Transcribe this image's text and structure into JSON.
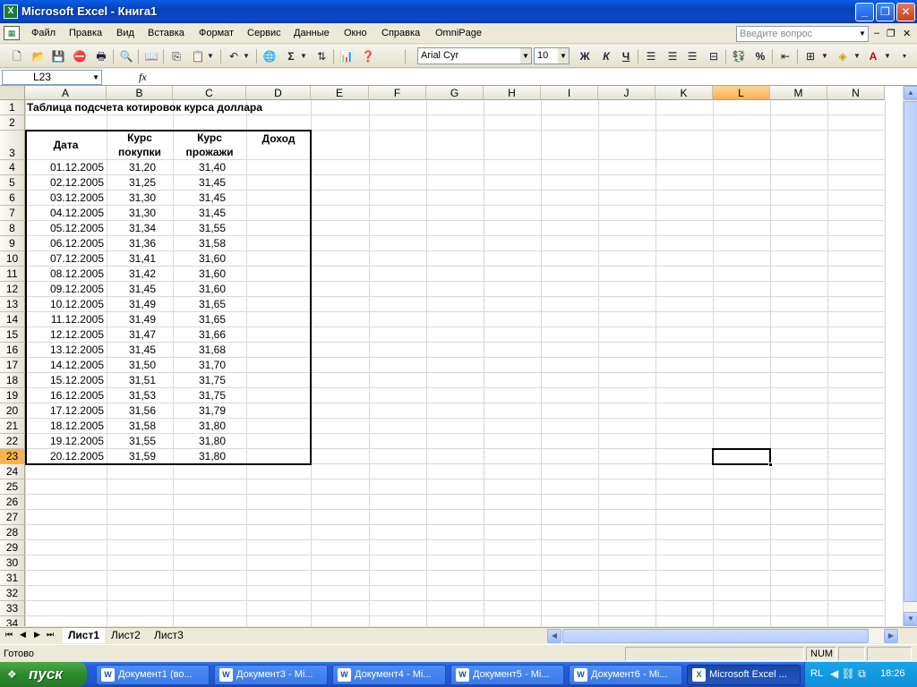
{
  "window": {
    "title": "Microsoft Excel - Книга1",
    "minimize": "_",
    "maximize": "❐",
    "close": "✕"
  },
  "menu": {
    "items": [
      "Файл",
      "Правка",
      "Вид",
      "Вставка",
      "Формат",
      "Сервис",
      "Данные",
      "Окно",
      "Справка",
      "OmniPage"
    ],
    "help_placeholder": "Введите вопрос"
  },
  "toolbar": {
    "font": "Arial Cyr",
    "font_size": "10",
    "bold": "Ж",
    "italic": "К",
    "underline": "Ч",
    "sum": "Σ",
    "percent": "%"
  },
  "formula_bar": {
    "name_box": "L23",
    "fx": "fx",
    "value": ""
  },
  "grid": {
    "columns": [
      "A",
      "B",
      "C",
      "D",
      "E",
      "F",
      "G",
      "H",
      "I",
      "J",
      "K",
      "L",
      "M",
      "N"
    ],
    "active_column": "L",
    "active_row": 23,
    "row_count": 34,
    "title": "Таблица подсчета котировок курса доллара",
    "headers": {
      "date": "Дата",
      "buy_1": "Курс",
      "buy_2": "покупки",
      "sell_1": "Курс",
      "sell_2": "прожажи",
      "income": "Доход"
    },
    "rows": [
      {
        "date": "01.12.2005",
        "buy": "31,20",
        "sell": "31,40"
      },
      {
        "date": "02.12.2005",
        "buy": "31,25",
        "sell": "31,45"
      },
      {
        "date": "03.12.2005",
        "buy": "31,30",
        "sell": "31,45"
      },
      {
        "date": "04.12.2005",
        "buy": "31,30",
        "sell": "31,45"
      },
      {
        "date": "05.12.2005",
        "buy": "31,34",
        "sell": "31,55"
      },
      {
        "date": "06.12.2005",
        "buy": "31,36",
        "sell": "31,58"
      },
      {
        "date": "07.12.2005",
        "buy": "31,41",
        "sell": "31,60"
      },
      {
        "date": "08.12.2005",
        "buy": "31,42",
        "sell": "31,60"
      },
      {
        "date": "09.12.2005",
        "buy": "31,45",
        "sell": "31,60"
      },
      {
        "date": "10.12.2005",
        "buy": "31,49",
        "sell": "31,65"
      },
      {
        "date": "11.12.2005",
        "buy": "31,49",
        "sell": "31,65"
      },
      {
        "date": "12.12.2005",
        "buy": "31,47",
        "sell": "31,66"
      },
      {
        "date": "13.12.2005",
        "buy": "31,45",
        "sell": "31,68"
      },
      {
        "date": "14.12.2005",
        "buy": "31,50",
        "sell": "31,70"
      },
      {
        "date": "15.12.2005",
        "buy": "31,51",
        "sell": "31,75"
      },
      {
        "date": "16.12.2005",
        "buy": "31,53",
        "sell": "31,75"
      },
      {
        "date": "17.12.2005",
        "buy": "31,56",
        "sell": "31,79"
      },
      {
        "date": "18.12.2005",
        "buy": "31,58",
        "sell": "31,80"
      },
      {
        "date": "19.12.2005",
        "buy": "31,55",
        "sell": "31,80"
      },
      {
        "date": "20.12.2005",
        "buy": "31,59",
        "sell": "31,80"
      }
    ]
  },
  "sheets": {
    "tabs": [
      "Лист1",
      "Лист2",
      "Лист3"
    ],
    "active": "Лист1"
  },
  "status": {
    "text": "Готово",
    "num": "NUM"
  },
  "taskbar": {
    "start": "пуск",
    "tasks": [
      "Документ1 (во...",
      "Документ3 - Mi...",
      "Документ4 - Mi...",
      "Документ5 - Mi...",
      "Документ6 - Mi...",
      "Microsoft Excel ..."
    ],
    "active_task": 5,
    "lang": "RL",
    "clock": "18:26"
  }
}
